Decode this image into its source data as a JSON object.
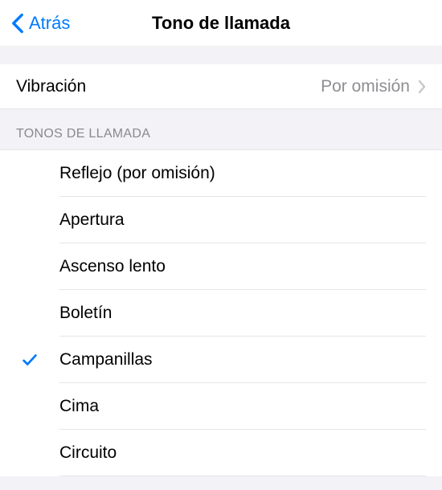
{
  "nav": {
    "back_label": "Atrás",
    "title": "Tono de llamada"
  },
  "vibration": {
    "label": "Vibración",
    "value": "Por omisión"
  },
  "tones": {
    "header": "TONOS DE LLAMADA",
    "items": [
      {
        "label": "Reflejo (por omisión)",
        "selected": false
      },
      {
        "label": "Apertura",
        "selected": false
      },
      {
        "label": "Ascenso lento",
        "selected": false
      },
      {
        "label": "Boletín",
        "selected": false
      },
      {
        "label": "Campanillas",
        "selected": true
      },
      {
        "label": "Cima",
        "selected": false
      },
      {
        "label": "Circuito",
        "selected": false
      }
    ]
  }
}
